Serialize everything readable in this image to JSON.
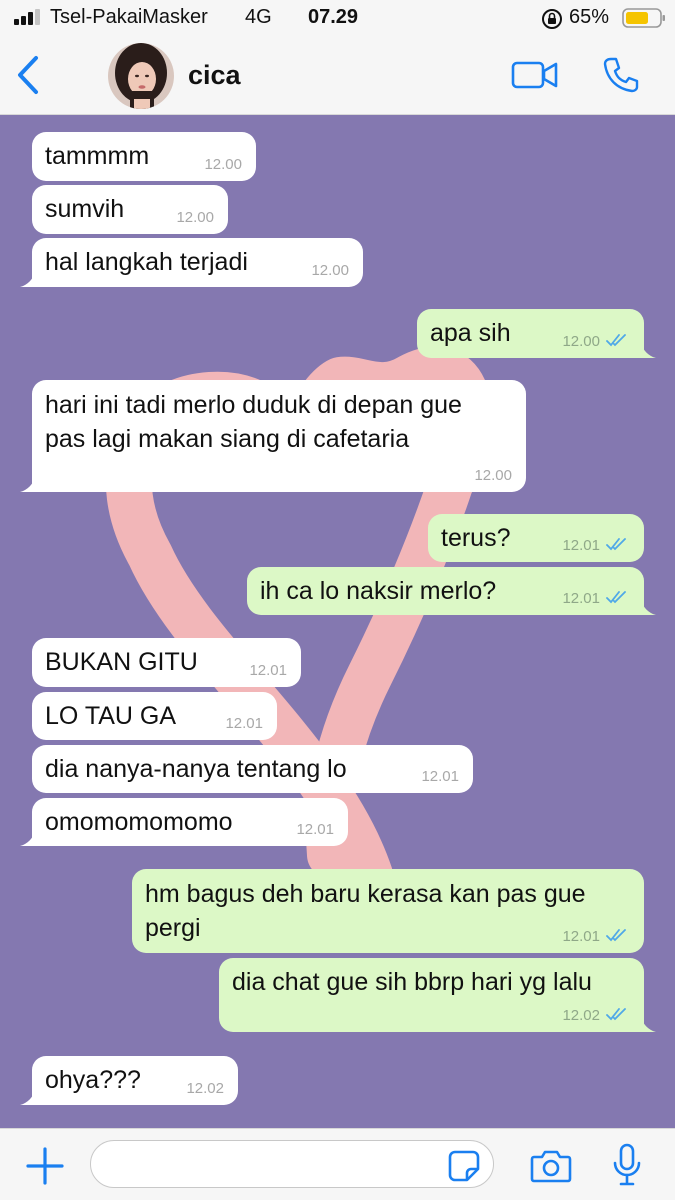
{
  "status_bar": {
    "carrier": "Tsel-PakaiMasker",
    "network": "4G",
    "time": "07.29",
    "battery": "65%"
  },
  "header": {
    "contact_name": "cica"
  },
  "messages": [
    {
      "dir": "in",
      "text": "tammmm",
      "time": "12.00"
    },
    {
      "dir": "in",
      "text": "sumvih",
      "time": "12.00"
    },
    {
      "dir": "in",
      "text": "hal langkah terjadi",
      "time": "12.00"
    },
    {
      "dir": "out",
      "text": "apa sih",
      "time": "12.00"
    },
    {
      "dir": "in",
      "text_line1": "hari ini tadi merlo duduk di depan gue",
      "text_line2": "pas lagi makan siang di cafetaria",
      "time": "12.00"
    },
    {
      "dir": "out",
      "text": "terus?",
      "time": "12.01"
    },
    {
      "dir": "out",
      "text": "ih ca lo naksir merlo?",
      "time": "12.01"
    },
    {
      "dir": "in",
      "text": "BUKAN GITU",
      "time": "12.01"
    },
    {
      "dir": "in",
      "text": "LO TAU GA",
      "time": "12.01"
    },
    {
      "dir": "in",
      "text": "dia nanya-nanya tentang lo",
      "time": "12.01"
    },
    {
      "dir": "in",
      "text": "omomomomomo",
      "time": "12.01"
    },
    {
      "dir": "out",
      "text_line1": "hm bagus deh baru kerasa kan pas gue",
      "text_line2": "pergi",
      "time": "12.01"
    },
    {
      "dir": "out",
      "text": "dia chat gue sih bbrp hari yg lalu",
      "time": "12.02"
    },
    {
      "dir": "in",
      "text": "ohya???",
      "time": "12.02"
    }
  ],
  "composer": {
    "value": "",
    "placeholder": ""
  },
  "icons": {
    "back": "chevron-left-icon",
    "video": "video-call-icon",
    "phone": "phone-call-icon",
    "plus": "plus-icon",
    "sticker": "sticker-icon",
    "camera": "camera-icon",
    "mic": "microphone-icon"
  },
  "colors": {
    "accent": "#1a7ff0",
    "chat_background": "#8478b0",
    "heart": "#f2b6b8",
    "outgoing_bubble": "#dcf8c6",
    "incoming_bubble": "#ffffff",
    "read_ticks": "#4fa8e8"
  }
}
